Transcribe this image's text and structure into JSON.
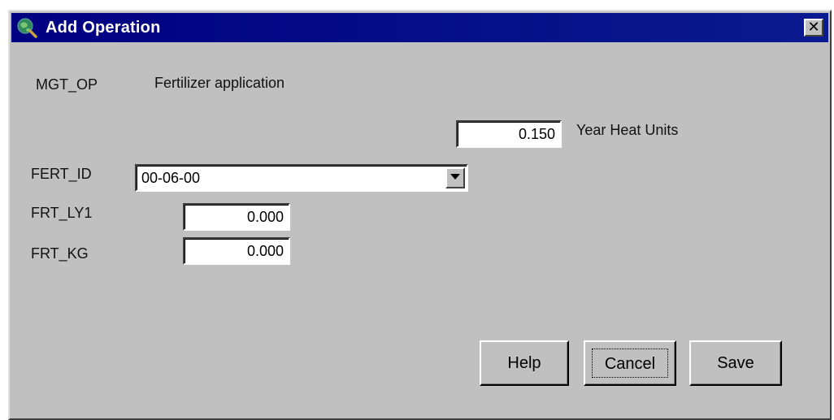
{
  "window": {
    "title": "Add Operation",
    "close_glyph": "✕",
    "icon": "globe-magnifier-icon"
  },
  "form": {
    "mgt_op_label": "MGT_OP",
    "mgt_op_value": "Fertilizer application",
    "heat_units_value": "0.150",
    "heat_units_label": "Year Heat Units",
    "fert_id_label": "FERT_ID",
    "fert_id_value": "00-06-00",
    "frt_ly1_label": "FRT_LY1",
    "frt_ly1_value": "0.000",
    "frt_kg_label": "FRT_KG",
    "frt_kg_value": "0.000"
  },
  "buttons": {
    "help_label": "Help",
    "cancel_label": "Cancel",
    "save_label": "Save"
  },
  "colors": {
    "titlebar": "#000080",
    "face": "#c0c0c0",
    "field": "#ffffff"
  }
}
